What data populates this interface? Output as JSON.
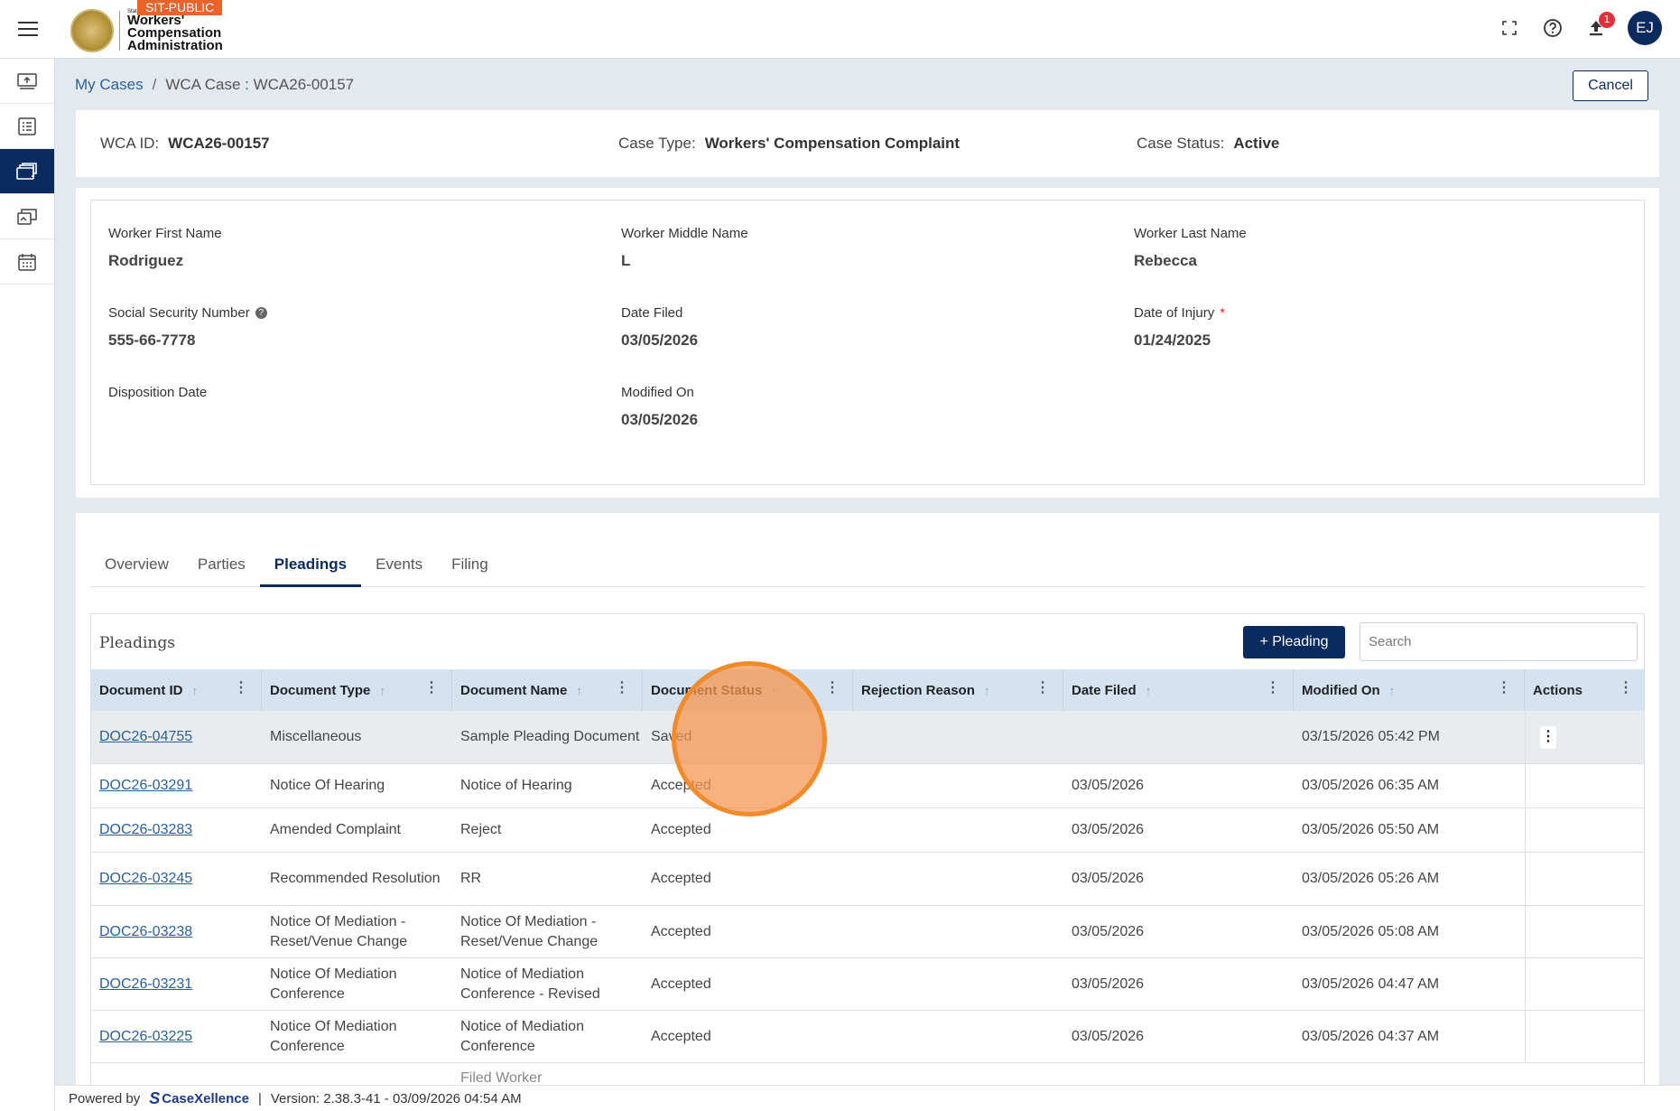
{
  "header": {
    "env_badge": "SIT-PUBLIC",
    "logo_small": "State",
    "logo_line1": "Workers'",
    "logo_line2": "Compensation",
    "logo_line3": "Administration",
    "notification_count": "1",
    "avatar_initials": "EJ"
  },
  "breadcrumb": {
    "root": "My Cases",
    "separator": "/",
    "current": "WCA Case : WCA26-00157"
  },
  "actions": {
    "cancel_label": "Cancel"
  },
  "summary": {
    "wca_id_label": "WCA ID:",
    "wca_id_value": "WCA26-00157",
    "case_type_label": "Case Type:",
    "case_type_value": "Workers' Compensation Complaint",
    "case_status_label": "Case Status:",
    "case_status_value": "Active"
  },
  "details": {
    "first_name_label": "Worker First Name",
    "first_name_value": "Rodriguez",
    "middle_name_label": "Worker Middle Name",
    "middle_name_value": "L",
    "last_name_label": "Worker Last Name",
    "last_name_value": "Rebecca",
    "ssn_label": "Social Security Number",
    "ssn_value": "555-66-7778",
    "date_filed_label": "Date Filed",
    "date_filed_value": "03/05/2026",
    "date_of_injury_label": "Date of Injury",
    "date_of_injury_value": "01/24/2025",
    "disposition_label": "Disposition Date",
    "disposition_value": "",
    "modified_on_label": "Modified On",
    "modified_on_value": "03/05/2026"
  },
  "tabs": [
    "Overview",
    "Parties",
    "Pleadings",
    "Events",
    "Filing"
  ],
  "active_tab": "Pleadings",
  "grid": {
    "title": "Pleadings",
    "add_label": "+ Pleading",
    "search_placeholder": "Search",
    "columns": [
      "Document ID",
      "Document Type",
      "Document Name",
      "Document Status",
      "Rejection Reason",
      "Date Filed",
      "Modified On",
      "Actions"
    ],
    "rows": [
      {
        "id": "DOC26-04755",
        "type": "Miscellaneous",
        "name": "Sample Pleading Document",
        "status": "Saved",
        "reason": "",
        "filed": "",
        "modified": "03/15/2026 05:42 PM"
      },
      {
        "id": "DOC26-03291",
        "type": "Notice Of Hearing",
        "name": "Notice of Hearing",
        "status": "Accepted",
        "reason": "",
        "filed": "03/05/2026",
        "modified": "03/05/2026 06:35 AM"
      },
      {
        "id": "DOC26-03283",
        "type": "Amended Complaint",
        "name": "Reject",
        "status": "Accepted",
        "reason": "",
        "filed": "03/05/2026",
        "modified": "03/05/2026 05:50 AM"
      },
      {
        "id": "DOC26-03245",
        "type": "Recommended Resolution",
        "name": "RR",
        "status": "Accepted",
        "reason": "",
        "filed": "03/05/2026",
        "modified": "03/05/2026 05:26 AM"
      },
      {
        "id": "DOC26-03238",
        "type": "Notice Of Mediation - Reset/Venue Change",
        "name": "Notice Of Mediation - Reset/Venue Change",
        "status": "Accepted",
        "reason": "",
        "filed": "03/05/2026",
        "modified": "03/05/2026 05:08 AM"
      },
      {
        "id": "DOC26-03231",
        "type": "Notice Of Mediation Conference",
        "name": "Notice of Mediation Conference - Revised",
        "status": "Accepted",
        "reason": "",
        "filed": "03/05/2026",
        "modified": "03/05/2026 04:47 AM"
      },
      {
        "id": "DOC26-03225",
        "type": "Notice Of Mediation Conference",
        "name": "Notice of Mediation Conference",
        "status": "Accepted",
        "reason": "",
        "filed": "03/05/2026",
        "modified": "03/05/2026 04:37 AM"
      },
      {
        "id": "",
        "type": "",
        "name": "Filed Worker",
        "status": "",
        "reason": "",
        "filed": "",
        "modified": ""
      }
    ]
  },
  "footer": {
    "powered_by": "Powered by",
    "brand": "CaseXellence",
    "separator": "|",
    "version": "Version: 2.38.3-41 - 03/09/2026 04:54 AM"
  },
  "icons": {
    "menu": "hamburger-icon",
    "fullscreen": "fullscreen-icon",
    "help": "help-icon",
    "notifications": "upload-bell-icon"
  },
  "colors": {
    "primary": "#0b2a5e",
    "header_row": "#d5e3f1",
    "env_badge": "#e8642c",
    "click_indicator": "#f08a2a"
  }
}
